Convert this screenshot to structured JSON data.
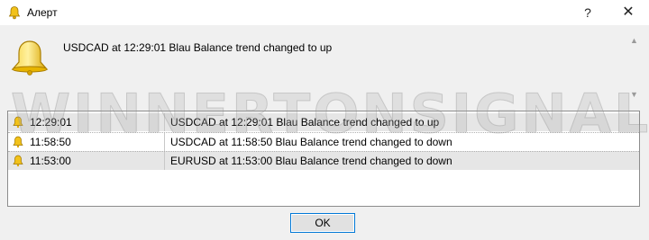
{
  "window": {
    "title": "Алерт",
    "help_label": "?",
    "close_label": "✕",
    "title_icon": "bell-icon"
  },
  "main": {
    "message": "USDCAD at 12:29:01 Blau Balance trend changed to up",
    "icon": "bell-icon"
  },
  "alerts": [
    {
      "time": "12:29:01",
      "message": "USDCAD at 12:29:01 Blau Balance trend changed to up",
      "selected": true
    },
    {
      "time": "11:58:50",
      "message": "USDCAD at 11:58:50 Blau Balance trend changed to down",
      "selected": false
    },
    {
      "time": "11:53:00",
      "message": "EURUSD at 11:53:00 Blau Balance trend changed to down",
      "selected": true
    }
  ],
  "watermark": "WINNERTONSIGNALS.COM",
  "buttons": {
    "ok_label": "OK"
  },
  "colors": {
    "bell_gold": "#f2c21a",
    "bell_dark": "#b88a00",
    "focus_border": "#0078d7",
    "client_bg": "#f0f0f0"
  }
}
